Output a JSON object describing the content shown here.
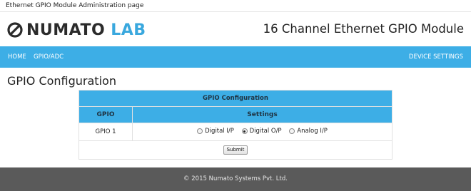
{
  "browser": {
    "page_title": "Ethernet GPIO Module Administration page"
  },
  "header": {
    "logo_dark": "NUMATO",
    "logo_blue": "LAB",
    "product_title": "16 Channel Ethernet GPIO Module"
  },
  "nav": {
    "home": "HOME",
    "gpio_adc": "GPIO/ADC",
    "device_settings": "DEVICE SETTINGS",
    "color": "#3daee6"
  },
  "main": {
    "heading": "GPIO Configuration",
    "table": {
      "title": "GPIO Configuration",
      "columns": [
        "GPIO",
        "Settings"
      ],
      "rows": [
        {
          "gpio": "GPIO 1",
          "options": [
            "Digital I/P",
            "Digital O/P",
            "Analog I/P"
          ],
          "selected": "Digital O/P"
        }
      ],
      "submit_label": "Submit"
    }
  },
  "footer": {
    "text": "© 2015 Numato Systems Pvt. Ltd."
  }
}
